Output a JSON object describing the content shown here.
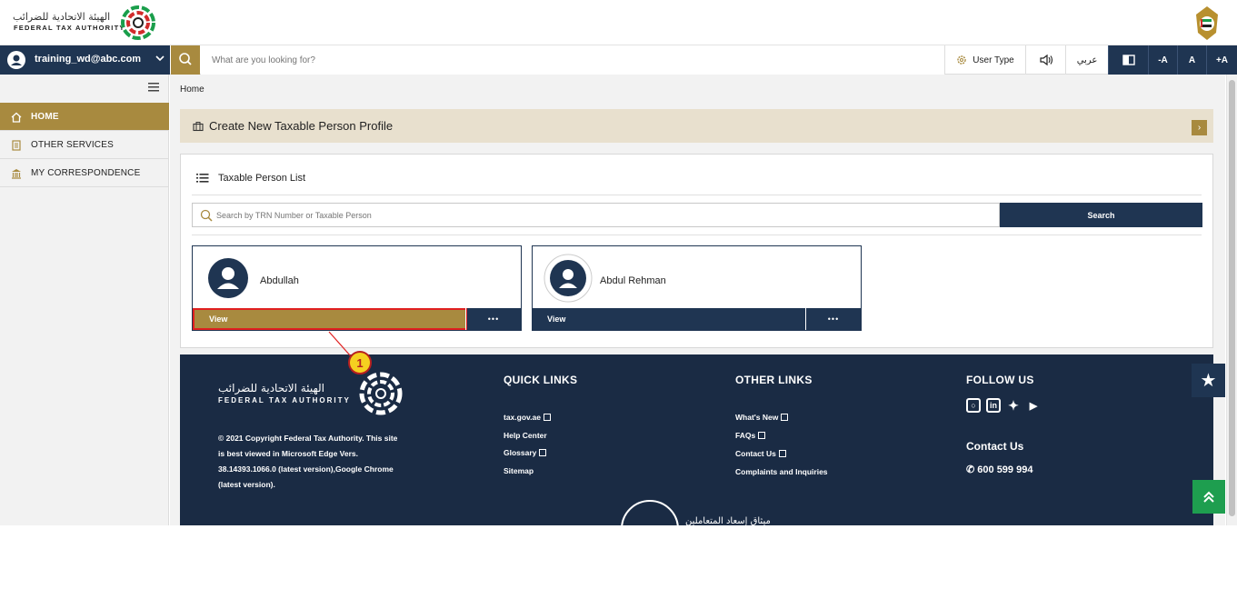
{
  "header": {
    "logo_ar": "الهيئة الاتحادية للضرائب",
    "logo_en": "FEDERAL TAX AUTHORITY"
  },
  "nav": {
    "username": "training_wd@abc.com",
    "search_placeholder": "What are you looking for?",
    "user_type": "User Type",
    "language": "عربي",
    "font_decrease": "-A",
    "font_normal": "A",
    "font_increase": "+A"
  },
  "sidebar": {
    "items": [
      {
        "label": "HOME",
        "icon": "home-icon"
      },
      {
        "label": "OTHER SERVICES",
        "icon": "document-icon"
      },
      {
        "label": "MY CORRESPONDENCE",
        "icon": "building-icon"
      }
    ]
  },
  "main": {
    "breadcrumb": "Home",
    "banner_title": "Create New Taxable Person Profile",
    "list_title": "Taxable Person List",
    "search_placeholder": "Search by TRN Number or Taxable Person",
    "search_button": "Search",
    "cards": [
      {
        "name": "Abdullah",
        "view_label": "View",
        "more_label": "•••"
      },
      {
        "name": "Abdul Rehman",
        "view_label": "View",
        "more_label": "•••"
      }
    ]
  },
  "footer": {
    "logo_ar": "الهيئة الاتحادية للضرائب",
    "logo_en": "FEDERAL TAX AUTHORITY",
    "copyright": "© 2021 Copyright Federal Tax Authority. This site is best viewed in Microsoft Edge Vers. 38.14393.1066.0 (latest version),Google Chrome (latest version).",
    "quick_links_title": "QUICK LINKS",
    "quick_links": [
      "tax.gov.ae",
      "Help Center",
      "Glossary",
      "Sitemap"
    ],
    "other_links_title": "OTHER LINKS",
    "other_links": [
      "What's New",
      "FAQs",
      "Contact Us",
      "Complaints and Inquiries"
    ],
    "follow_title": "FOLLOW US",
    "contact_title": "Contact Us",
    "phone": "600 599 994",
    "seal_text": "ميثاق إسعاد المتعاملين"
  },
  "callout": {
    "number": "1"
  },
  "colors": {
    "navy": "#1f3552",
    "gold": "#a88a3f",
    "footer_bg": "#1a2b44",
    "green": "#1e9e4f",
    "highlight_red": "#e02020"
  }
}
